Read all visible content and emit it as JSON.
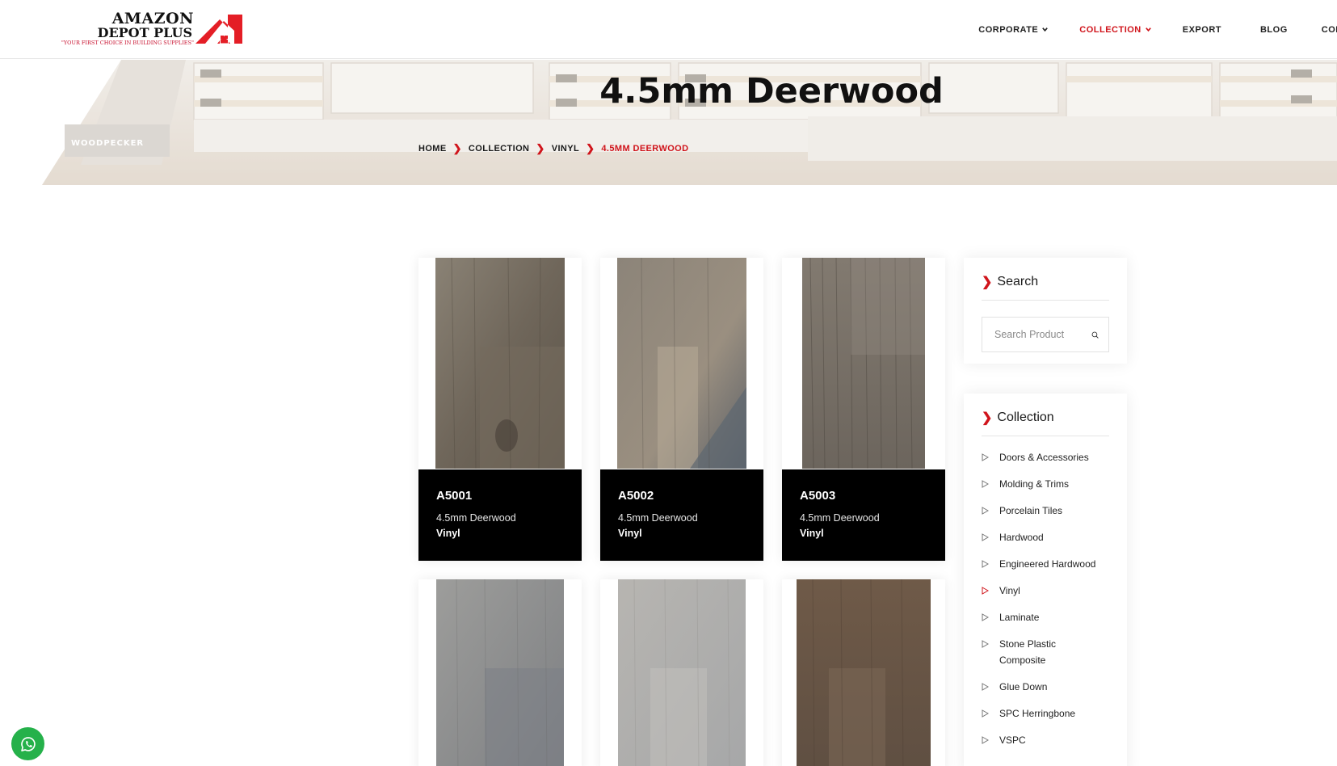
{
  "header": {
    "logo": {
      "line1": "AMAZON",
      "line2": "DEPOT PLUS",
      "tagline": "\"YOUR FIRST CHOICE IN BUILDING SUPPLIES\""
    },
    "nav": [
      {
        "label": "CORPORATE",
        "has_dropdown": true,
        "active": false
      },
      {
        "label": "COLLECTION",
        "has_dropdown": true,
        "active": true
      },
      {
        "label": "EXPORT",
        "has_dropdown": false,
        "active": false
      },
      {
        "label": "BLOG",
        "has_dropdown": false,
        "active": false
      },
      {
        "label": "CONTAC",
        "has_dropdown": false,
        "active": false
      }
    ]
  },
  "banner": {
    "title": "4.5mm Deerwood",
    "watermark": "WOODPECKER",
    "breadcrumb": [
      "HOME",
      "COLLECTION",
      "VINYL",
      "4.5MM DEERWOOD"
    ]
  },
  "products": [
    {
      "code": "A5001",
      "name": "4.5mm Deerwood",
      "category": "Vinyl"
    },
    {
      "code": "A5002",
      "name": "4.5mm Deerwood",
      "category": "Vinyl"
    },
    {
      "code": "A5003",
      "name": "4.5mm Deerwood",
      "category": "Vinyl"
    },
    {
      "code": "",
      "name": "",
      "category": ""
    },
    {
      "code": "",
      "name": "",
      "category": ""
    },
    {
      "code": "",
      "name": "",
      "category": ""
    }
  ],
  "sidebar": {
    "search": {
      "title": "Search",
      "placeholder": "Search Product"
    },
    "collection": {
      "title": "Collection",
      "items": [
        "Doors & Accessories",
        "Molding & Trims",
        "Porcelain Tiles",
        "Hardwood",
        "Engineered Hardwood",
        "Vinyl",
        "Laminate",
        "Stone Plastic Composite",
        "Glue Down",
        "SPC Herringbone",
        "VSPC"
      ],
      "active_item": "Vinyl"
    }
  },
  "colors": {
    "accent": "#d0141b",
    "card_info_bg": "#000000",
    "whatsapp": "#25b14a"
  },
  "icons": [
    "chevron-down-icon",
    "search-icon",
    "whatsapp-icon",
    "triangle-right-icon"
  ]
}
